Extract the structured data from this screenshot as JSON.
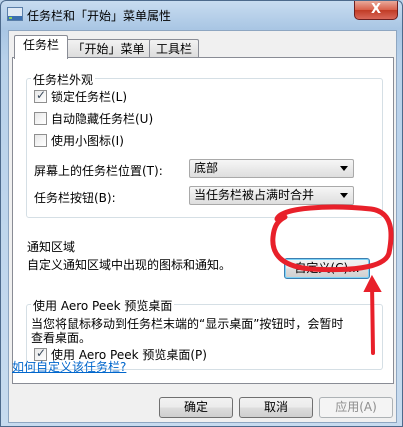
{
  "window": {
    "title": "任务栏和「开始」菜单属性",
    "close_label": "X"
  },
  "tabs": [
    {
      "label": "任务栏",
      "active": true
    },
    {
      "label": "「开始」菜单",
      "active": false
    },
    {
      "label": "工具栏",
      "active": false
    }
  ],
  "appearance": {
    "legend": "任务栏外观",
    "lock_label": "锁定任务栏(L)",
    "autohide_label": "自动隐藏任务栏(U)",
    "small_icons_label": "使用小图标(I)",
    "location_label": "屏幕上的任务栏位置(T):",
    "location_value": "底部",
    "buttons_label": "任务栏按钮(B):",
    "buttons_value": "当任务栏被占满时合并"
  },
  "notification": {
    "legend": "通知区域",
    "text": "自定义通知区域中出现的图标和通知。",
    "customize_button": "自定义(C)..."
  },
  "aero_peek": {
    "legend": "使用 Aero Peek 预览桌面",
    "description_line1": "当您将鼠标移动到任务栏末端的“显示桌面”按钮时，会暂时",
    "description_line2": "查看桌面。",
    "checkbox_label": "使用 Aero Peek 预览桌面(P)"
  },
  "help_link": "如何自定义该任务栏?",
  "footer": {
    "ok": "确定",
    "cancel": "取消",
    "apply": "应用(A)"
  },
  "colors": {
    "annotation_red": "#e8202a",
    "link": "#0066cc",
    "titlebar": "#a9c6e4"
  }
}
